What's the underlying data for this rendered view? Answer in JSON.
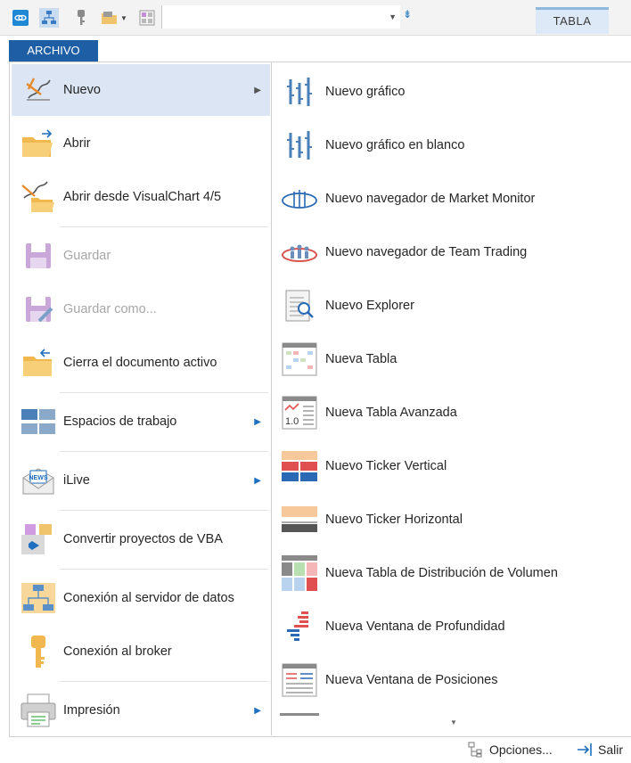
{
  "toolbar": {
    "buttons": [
      {
        "name": "link-icon"
      },
      {
        "name": "server-connection-icon"
      },
      {
        "name": "broker-key-icon"
      },
      {
        "name": "open-folder-icon"
      },
      {
        "name": "workspace-icon"
      }
    ],
    "combo_value": "",
    "tab_label": "TABLA"
  },
  "archivo_tab": "ARCHIVO",
  "menu": [
    {
      "label": "Nuevo",
      "icon": "new-chart-icon",
      "active": true,
      "submenu": true,
      "disabled": false
    },
    {
      "label": "Abrir",
      "icon": "open-folder-icon",
      "active": false,
      "submenu": false,
      "disabled": false
    },
    {
      "label": "Abrir desde VisualChart 4/5",
      "icon": "open-visualchart-icon",
      "active": false,
      "submenu": false,
      "disabled": false
    },
    {
      "label": "Guardar",
      "icon": "save-icon",
      "active": false,
      "submenu": false,
      "disabled": true
    },
    {
      "label": "Guardar como...",
      "icon": "save-as-icon",
      "active": false,
      "submenu": false,
      "disabled": true
    },
    {
      "label": "Cierra el documento activo",
      "icon": "close-document-icon",
      "active": false,
      "submenu": false,
      "disabled": false
    },
    {
      "label": "Espacios de trabajo",
      "icon": "workspaces-icon",
      "active": false,
      "submenu": true,
      "disabled": false
    },
    {
      "label": "iLive",
      "icon": "news-icon",
      "active": false,
      "submenu": true,
      "disabled": false
    },
    {
      "label": "Convertir proyectos de VBA",
      "icon": "convert-vba-icon",
      "active": false,
      "submenu": false,
      "disabled": false
    },
    {
      "label": "Conexión al servidor de datos",
      "icon": "data-server-icon",
      "active": false,
      "submenu": false,
      "disabled": false
    },
    {
      "label": "Conexión al broker",
      "icon": "broker-key-icon",
      "active": false,
      "submenu": false,
      "disabled": false
    },
    {
      "label": "Impresión",
      "icon": "printer-icon",
      "active": false,
      "submenu": true,
      "disabled": false
    }
  ],
  "submenu": [
    {
      "label": "Nuevo gráfico",
      "icon": "chart-icon"
    },
    {
      "label": "Nuevo gráfico en blanco",
      "icon": "blank-chart-icon"
    },
    {
      "label": "Nuevo navegador de Market Monitor",
      "icon": "market-monitor-icon"
    },
    {
      "label": "Nuevo navegador de Team Trading",
      "icon": "team-trading-icon"
    },
    {
      "label": "Nuevo Explorer",
      "icon": "explorer-icon"
    },
    {
      "label": "Nueva Tabla",
      "icon": "table-icon"
    },
    {
      "label": "Nueva Tabla Avanzada",
      "icon": "advanced-table-icon"
    },
    {
      "label": "Nuevo Ticker Vertical",
      "icon": "vertical-ticker-icon"
    },
    {
      "label": "Nuevo Ticker Horizontal",
      "icon": "horizontal-ticker-icon"
    },
    {
      "label": "Nueva Tabla de Distribución de Volumen",
      "icon": "volume-distribution-icon"
    },
    {
      "label": "Nueva Ventana de Profundidad",
      "icon": "depth-window-icon"
    },
    {
      "label": "Nueva Ventana de Posiciones",
      "icon": "positions-window-icon"
    }
  ],
  "footer": {
    "options_label": "Opciones...",
    "exit_label": "Salir"
  }
}
